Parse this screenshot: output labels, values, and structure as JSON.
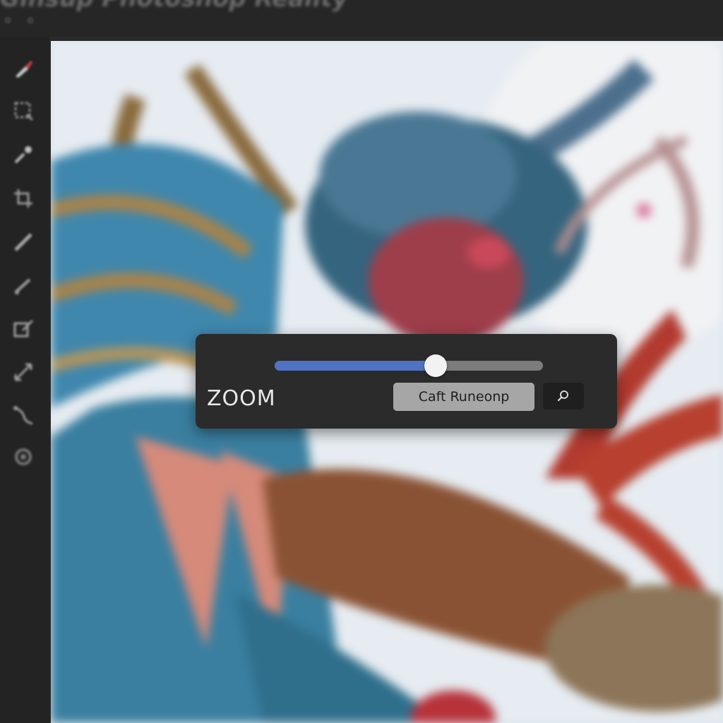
{
  "window": {
    "title": "Ginsup Photoshop Reality"
  },
  "toolbar": {
    "tools": [
      {
        "name": "brush-tool-icon",
        "accent": "#d8454b"
      },
      {
        "name": "marquee-tool-icon"
      },
      {
        "name": "eyedropper-tool-icon"
      },
      {
        "name": "crop-tool-icon"
      },
      {
        "name": "pencil-tool-icon"
      },
      {
        "name": "line-tool-icon"
      },
      {
        "name": "transform-tool-icon"
      },
      {
        "name": "move-tool-icon"
      },
      {
        "name": "lasso-tool-icon"
      },
      {
        "name": "settings-tool-icon"
      }
    ]
  },
  "zoom_panel": {
    "label": "ZOOM",
    "slider_value_percent": 60,
    "button_label": "Caft Runeonp",
    "search_icon": "search-icon",
    "accent_color": "#4f73c2"
  }
}
